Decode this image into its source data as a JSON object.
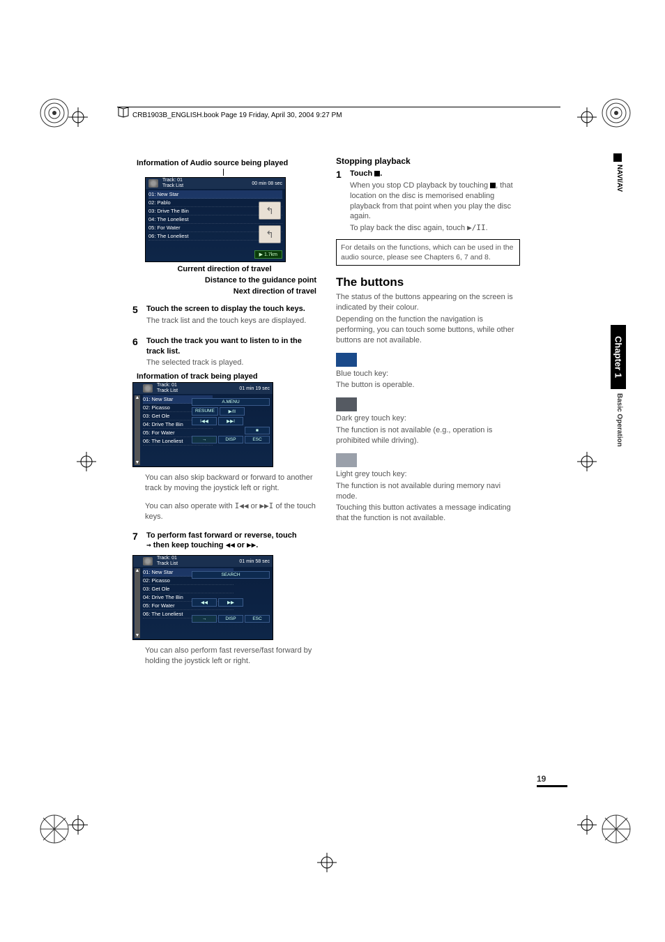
{
  "header": {
    "filename": "CRB1903B_ENGLISH.book  Page 19  Friday, April 30, 2004  9:27 PM"
  },
  "left": {
    "info_audio": "Information of Audio source being played",
    "cap_current_dir": "Current direction of travel",
    "cap_distance": "Distance to the guidance point",
    "cap_next_dir": "Next direction of travel",
    "screenshot1": {
      "track_header": "Track: 01",
      "track_list": "Track List",
      "time": "00 min   08 sec",
      "rows": [
        "01: New Star",
        "02: Pablo",
        "03: Drive The Bin",
        "04: The Loneliest",
        "05: For Water",
        "06: The Loneliest"
      ],
      "distance": "1.7km"
    },
    "step5": {
      "num": "5",
      "title": "Touch the screen to display the touch keys.",
      "body": "The track list and the touch keys are displayed."
    },
    "step6": {
      "num": "6",
      "title": "Touch the track you want to listen to in the track list.",
      "body": "The selected track is played.",
      "subcap": "Information of track being played",
      "p1": "You can also skip backward or forward to another track by moving the joystick left or right.",
      "p2_a": "You can also operate with ",
      "p2_b": " or ",
      "p2_c": " of the touch keys."
    },
    "screenshot2": {
      "track_header": "Track: 01",
      "track_list": "Track List",
      "time": "01 min   19 sec",
      "rows": [
        "01: New Star",
        "02: Picasso",
        "03: Get Ole",
        "04: Drive The Bin",
        "05: For Water",
        "06: The Loneliest"
      ],
      "btns": {
        "menu": "A.MENU",
        "resume": "RESUME",
        "play": "▶/II",
        "prev": "I◀◀",
        "next": "▶▶I",
        "stop": "■",
        "disp": "DISP",
        "esc": "ESC"
      }
    },
    "step7": {
      "num": "7",
      "title_a": "To perform fast forward or reverse, touch ",
      "title_b": " then keep touching ",
      "title_c": " or ",
      "title_d": ".",
      "body": "You can also perform fast reverse/fast forward by holding the joystick left or right."
    },
    "screenshot3": {
      "track_header": "Track: 01",
      "track_list": "Track List",
      "time": "01 min   58 sec",
      "rows": [
        "01: New Star",
        "02: Picasso",
        "03: Get Ole",
        "04: Drive The Bin",
        "05: For Water",
        "06: The Loneliest"
      ],
      "btns": {
        "search": "SEARCH",
        "rw": "◀◀",
        "ff": "▶▶",
        "disp": "DISP",
        "esc": "ESC"
      }
    }
  },
  "right": {
    "stop_h": "Stopping playback",
    "step1": {
      "num": "1",
      "title_a": "Touch ",
      "title_b": ".",
      "p1_a": "When you stop CD playback by touching ",
      "p1_b": ", that location on the disc is memorised enabling playback from that point when you play the disc again.",
      "p2_a": "To play back the disc again, touch ",
      "p2_b": "."
    },
    "note": "For details on the functions, which can be used in the audio source, please see Chapters 6, 7 and 8.",
    "buttons_h": "The buttons",
    "intro1": "The status of the buttons appearing on the screen is indicated by their colour.",
    "intro2": "Depending on the function the navigation is performing, you can touch some buttons, while other buttons are not available.",
    "blue_t": "Blue touch key:",
    "blue_d": "The button is operable.",
    "dgrey_t": "Dark grey touch key:",
    "dgrey_d": "The function is not available (e.g., operation is prohibited while driving).",
    "lgrey_t": "Light grey touch key:",
    "lgrey_d1": "The function is not available during memory navi mode.",
    "lgrey_d2": "Touching this button activates a message indicating that the function is not available."
  },
  "side": {
    "nav": "NAVI/AV",
    "chapter": "Chapter 1",
    "sub": "Basic Operation"
  },
  "pagenum": "19",
  "icons": {
    "stop": "■",
    "play_pause": "▶/II",
    "prev_track": "I◀◀",
    "next_track": "▶▶I",
    "rewind": "◀◀",
    "ffwd": "▶▶",
    "arrow": "→"
  }
}
